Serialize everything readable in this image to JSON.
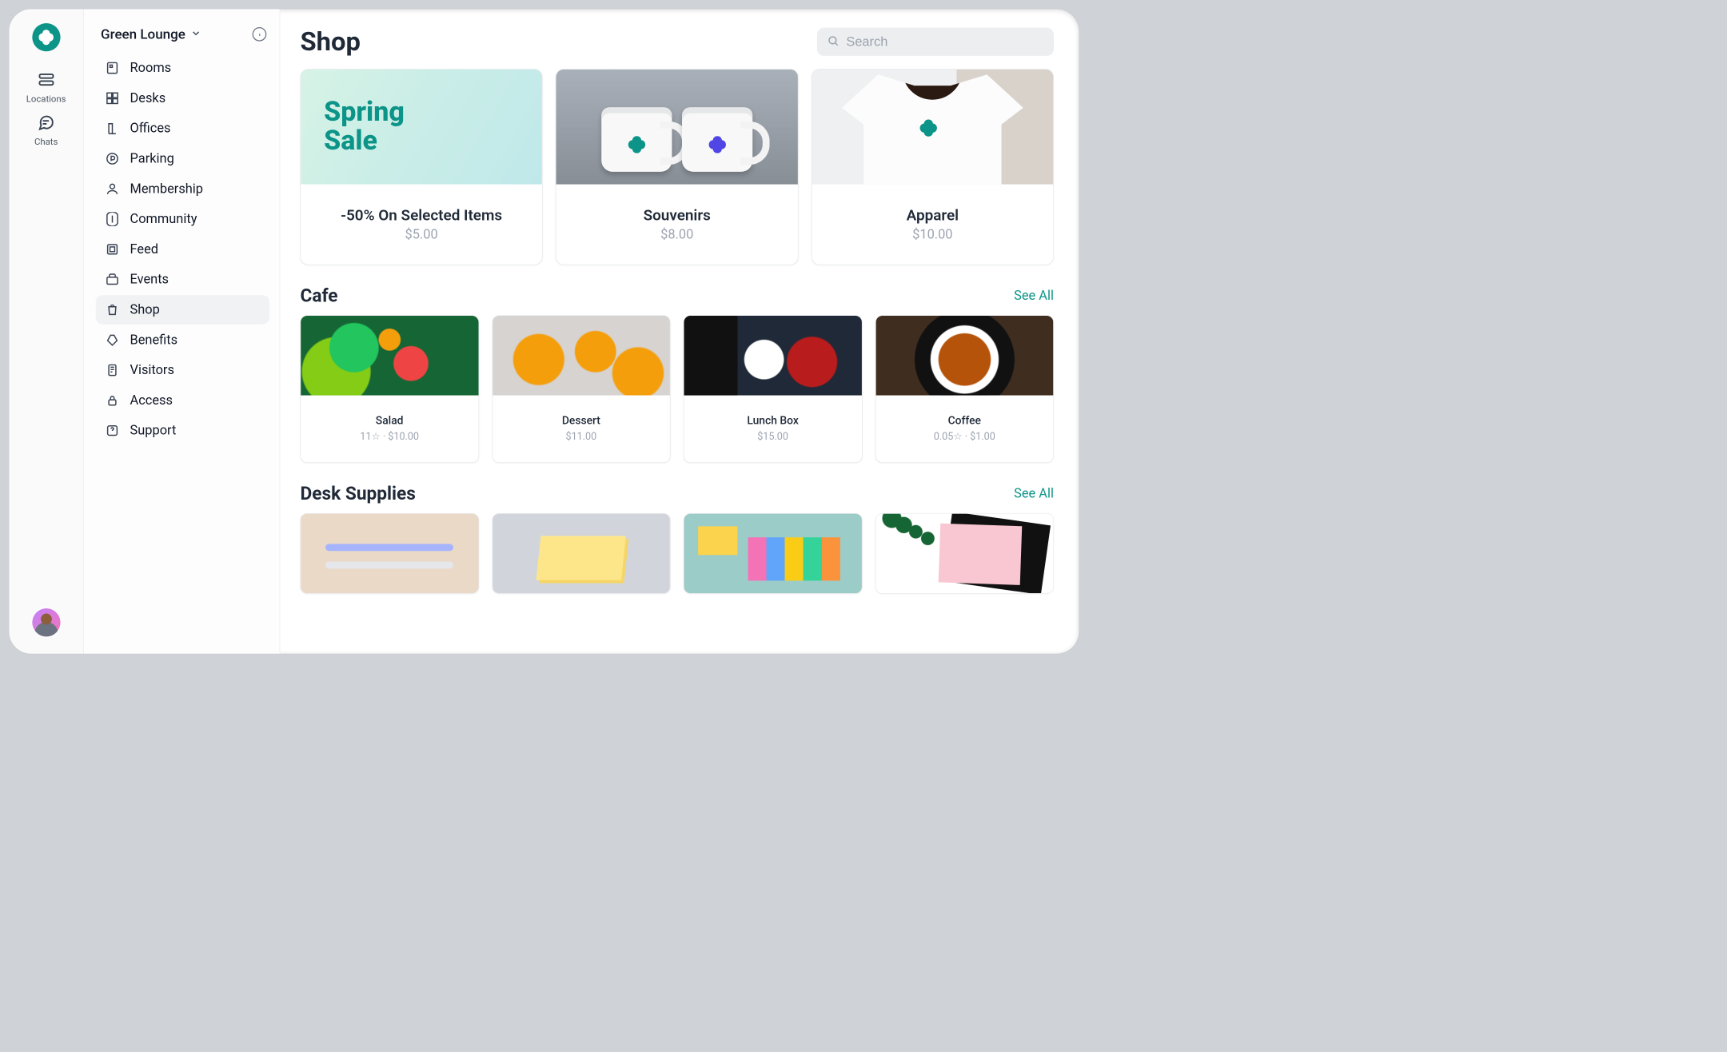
{
  "rail": {
    "items": [
      {
        "icon": "locations-icon",
        "label": "Locations"
      },
      {
        "icon": "chats-icon",
        "label": "Chats"
      }
    ]
  },
  "nav": {
    "location_name": "Green Lounge",
    "items": [
      {
        "icon": "rooms-icon",
        "label": "Rooms"
      },
      {
        "icon": "desks-icon",
        "label": "Desks"
      },
      {
        "icon": "offices-icon",
        "label": "Offices"
      },
      {
        "icon": "parking-icon",
        "label": "Parking"
      },
      {
        "icon": "membership-icon",
        "label": "Membership"
      },
      {
        "icon": "community-icon",
        "label": "Community"
      },
      {
        "icon": "feed-icon",
        "label": "Feed"
      },
      {
        "icon": "events-icon",
        "label": "Events"
      },
      {
        "icon": "shop-icon",
        "label": "Shop",
        "selected": true
      },
      {
        "icon": "benefits-icon",
        "label": "Benefits"
      },
      {
        "icon": "visitors-icon",
        "label": "Visitors"
      },
      {
        "icon": "access-icon",
        "label": "Access"
      },
      {
        "icon": "support-icon",
        "label": "Support"
      }
    ]
  },
  "main": {
    "title": "Shop",
    "search_placeholder": "Search",
    "hero": [
      {
        "title": "-50% On Selected Items",
        "price": "$5.00",
        "image": "spring-sale",
        "image_text_line1": "Spring",
        "image_text_line2": "Sale"
      },
      {
        "title": "Souvenirs",
        "price": "$8.00",
        "image": "mugs"
      },
      {
        "title": "Apparel",
        "price": "$10.00",
        "image": "apparel"
      }
    ],
    "sections": [
      {
        "title": "Cafe",
        "see_all": "See All",
        "products": [
          {
            "title": "Salad",
            "meta": "11☆ · $10.00",
            "image": "salad"
          },
          {
            "title": "Dessert",
            "meta": "$11.00",
            "image": "dessert"
          },
          {
            "title": "Lunch Box",
            "meta": "$15.00",
            "image": "lunch"
          },
          {
            "title": "Coffee",
            "meta": "0.05☆ · $1.00",
            "image": "coffee"
          }
        ]
      },
      {
        "title": "Desk Supplies",
        "see_all": "See All",
        "products": [
          {
            "title": "",
            "meta": "",
            "image": "pens"
          },
          {
            "title": "",
            "meta": "",
            "image": "notes"
          },
          {
            "title": "",
            "meta": "",
            "image": "clips"
          },
          {
            "title": "",
            "meta": "",
            "image": "journal"
          }
        ]
      }
    ]
  },
  "colors": {
    "brand": "#0d9488"
  }
}
